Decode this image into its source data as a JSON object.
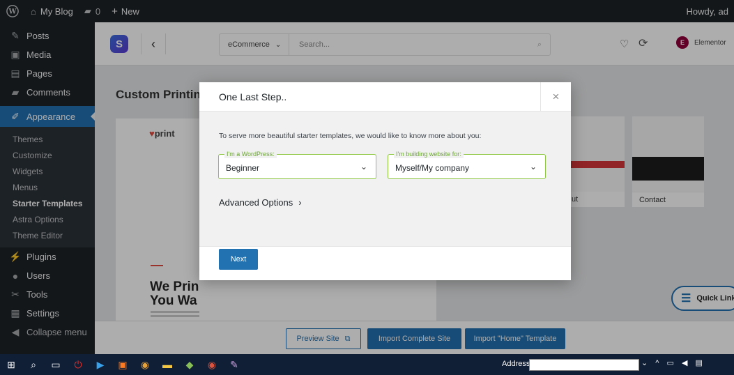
{
  "adminbar": {
    "site_name": "My Blog",
    "comments_count": "0",
    "new_label": "New",
    "howdy": "Howdy, ad"
  },
  "sidebar": {
    "items_top": [
      {
        "label": "Posts",
        "icon": "pin-icon"
      },
      {
        "label": "Media",
        "icon": "media-icon"
      },
      {
        "label": "Pages",
        "icon": "pages-icon"
      },
      {
        "label": "Comments",
        "icon": "comment-icon"
      }
    ],
    "appearance": "Appearance",
    "submenu": [
      "Themes",
      "Customize",
      "Widgets",
      "Menus",
      "Starter Templates",
      "Astra Options",
      "Theme Editor"
    ],
    "items_bottom": [
      {
        "label": "Plugins",
        "icon": "plugin-icon"
      },
      {
        "label": "Users",
        "icon": "users-icon"
      },
      {
        "label": "Tools",
        "icon": "wrench-icon"
      },
      {
        "label": "Settings",
        "icon": "settings-icon"
      },
      {
        "label": "Collapse menu",
        "icon": "collapse-icon"
      }
    ]
  },
  "starter": {
    "category": "eCommerce",
    "search_placeholder": "Search...",
    "builder": "Elementor",
    "page_title": "Custom Printin",
    "preview_brand": "print",
    "preview_hero_line1": "We Prin",
    "preview_hero_line2": "You Wa",
    "card_mid_label": "ut",
    "card_right_label": "Contact",
    "quick_links": "Quick Link"
  },
  "footer": {
    "preview_site": "Preview Site",
    "import_complete": "Import Complete Site",
    "import_home": "Import \"Home\" Template"
  },
  "modal": {
    "title": "One Last Step..",
    "intro": "To serve more beautiful starter templates, we would like to know more about you:",
    "field1_legend": "I'm a WordPress:",
    "field1_value": "Beginner",
    "field2_legend": "I'm building website for:",
    "field2_value": "Myself/My company",
    "advanced": "Advanced Options",
    "next": "Next"
  },
  "taskbar": {
    "address_label": "Address"
  },
  "colors": {
    "wp_dark": "#1d2327",
    "wp_blue": "#2271b1",
    "field_border": "#8cc63f"
  }
}
